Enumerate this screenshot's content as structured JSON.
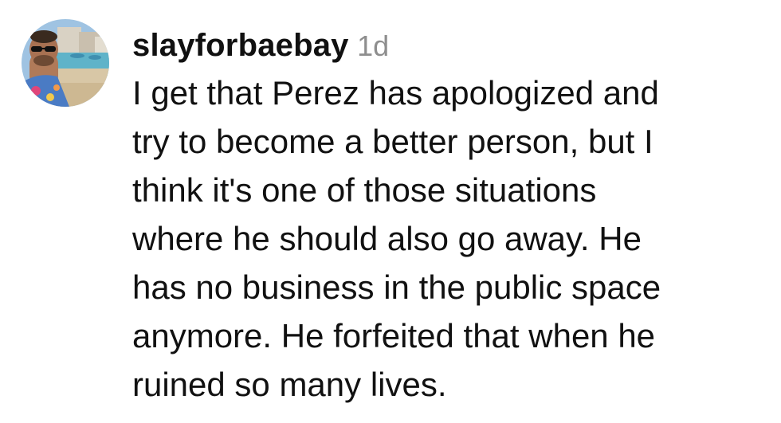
{
  "comment": {
    "username": "slayforbaebay",
    "timestamp": "1d",
    "avatar_icon": "user-avatar-beach-photo",
    "lines": [
      "I get that Perez has apologized and",
      "try to become a better person, but I",
      "think it's one of those situations",
      "where he should also go away. He",
      "has no business in the public space",
      "anymore. He forfeited that when he",
      "ruined so many lives."
    ]
  },
  "colors": {
    "text": "#111111",
    "timestamp": "#8e8e8e",
    "background": "#ffffff"
  }
}
